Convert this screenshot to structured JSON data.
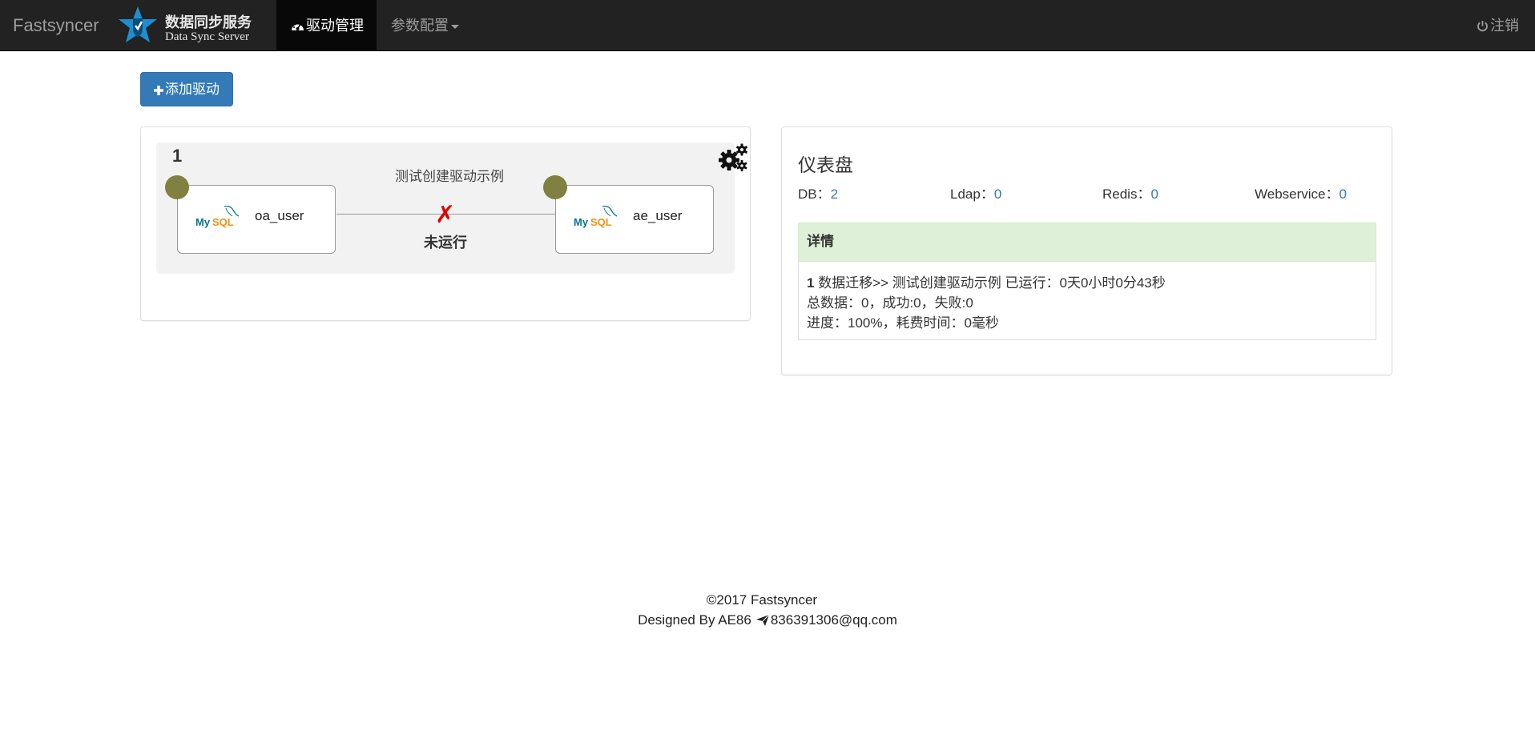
{
  "navbar": {
    "brand": "Fastsyncer",
    "logo_title_cn": "数据同步服务",
    "logo_title_en": "Data Sync Server",
    "nav_drivers_label": "驱动管理",
    "nav_params_label": "参数配置",
    "logout_label": "注销",
    "dashboard_icon": "dashboard-icon",
    "logout_icon": "power-icon"
  },
  "toolbar": {
    "add_driver_label": "添加驱动",
    "add_icon": "plus-icon"
  },
  "driver": {
    "id": "1",
    "name": "测试创建驱动示例",
    "source": {
      "db_type": "MySQL",
      "label": "oa_user"
    },
    "target": {
      "db_type": "MySQL",
      "label": "ae_user"
    },
    "status_mark": "✗",
    "status_text": "未运行",
    "status_color": "#e00000",
    "node_dot_color": "#808040",
    "settings_icon": "gears-icon"
  },
  "dashboard": {
    "title": "仪表盘",
    "stats": {
      "db_label": "DB：",
      "db_value": "2",
      "ldap_label": "Ldap：",
      "ldap_value": "0",
      "redis_label": "Redis：",
      "redis_value": "0",
      "ws_label": "Webservice：",
      "ws_value": "0"
    },
    "detail": {
      "header": "详情",
      "line1_num": "1",
      "line1_text": " 数据迁移>> 测试创建驱动示例 已运行：0天0小时0分43秒",
      "line2": "总数据：0，成功:0，失败:0",
      "line3": "进度：100%，耗费时间：0毫秒"
    }
  },
  "footer": {
    "copyright": "©2017 Fastsyncer",
    "designed_by": "Designed By AE86",
    "email": "836391306@qq.com",
    "email_icon": "send-icon"
  },
  "colors": {
    "navbar_bg": "#222222",
    "primary": "#337ab7",
    "detail_header_bg": "#dff0d8"
  }
}
